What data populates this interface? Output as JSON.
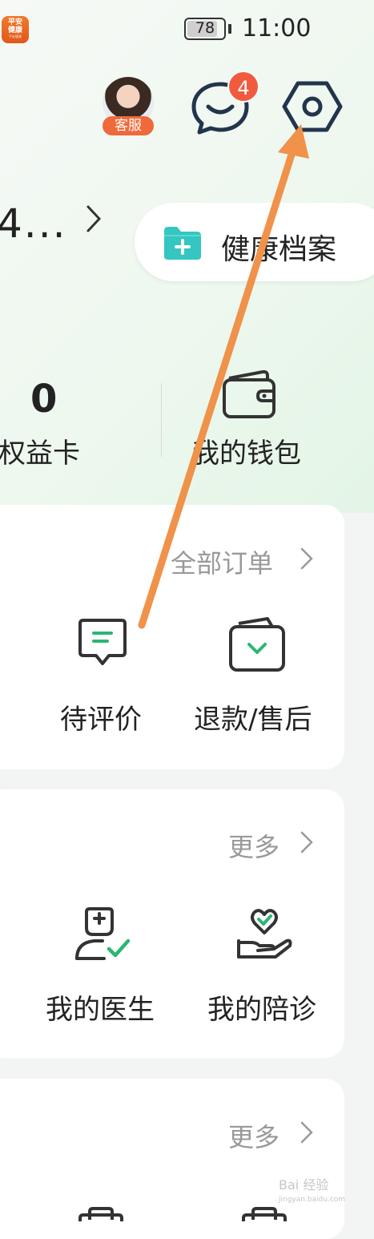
{
  "status_bar": {
    "app_badge_line1": "平安",
    "app_badge_line2": "健康",
    "app_badge_small": "平安健康",
    "battery": "78",
    "time": "11:00"
  },
  "header": {
    "service_label": "客服",
    "message_badge": "4",
    "settings_icon": "gear-hexagon-icon"
  },
  "user": {
    "id_partial": "4...",
    "health_records_label": "健康档案"
  },
  "stats": {
    "benefit_value": "0",
    "benefit_label": "权益卡",
    "wallet_label": "我的钱包"
  },
  "orders": {
    "all_orders": "全部订单",
    "items": [
      "待评价",
      "退款/售后"
    ]
  },
  "services": {
    "more": "更多",
    "items": [
      "我的医生",
      "我的陪诊"
    ]
  },
  "third_card": {
    "more": "更多"
  },
  "watermark": {
    "line1": "Bai  经验",
    "line2": "jingyan.baidu.com"
  },
  "annotation": {
    "arrow_color": "#f0924a"
  },
  "colors": {
    "accent_green": "#2bb673",
    "badge_orange": "#ef6a3a",
    "health_teal": "#35c6c1"
  }
}
